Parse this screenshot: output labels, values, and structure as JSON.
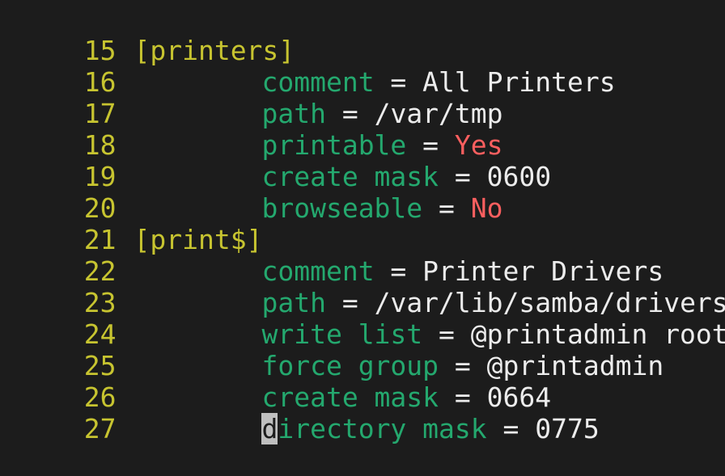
{
  "editor": {
    "lines": [
      {
        "number": "15",
        "type": "section",
        "text": "[printers]"
      },
      {
        "number": "16",
        "type": "kv",
        "key": "comment",
        "op": " = ",
        "value": "All Printers",
        "value_style": "plain"
      },
      {
        "number": "17",
        "type": "kv",
        "key": "path",
        "op": " = ",
        "value": "/var/tmp",
        "value_style": "plain"
      },
      {
        "number": "18",
        "type": "kv",
        "key": "printable",
        "op": " = ",
        "value": "Yes",
        "value_style": "boolean"
      },
      {
        "number": "19",
        "type": "kv",
        "key": "create mask",
        "op": " = ",
        "value": "0600",
        "value_style": "plain"
      },
      {
        "number": "20",
        "type": "kv",
        "key": "browseable",
        "op": " = ",
        "value": "No",
        "value_style": "boolean"
      },
      {
        "number": "21",
        "type": "section",
        "text": "[print$]"
      },
      {
        "number": "22",
        "type": "kv",
        "key": "comment",
        "op": " = ",
        "value": "Printer Drivers",
        "value_style": "plain"
      },
      {
        "number": "23",
        "type": "kv",
        "key": "path",
        "op": " = ",
        "value": "/var/lib/samba/drivers",
        "value_style": "plain"
      },
      {
        "number": "24",
        "type": "kv",
        "key": "write list",
        "op": " = ",
        "value": "@printadmin root",
        "value_style": "plain"
      },
      {
        "number": "25",
        "type": "kv",
        "key": "force group",
        "op": " = ",
        "value": "@printadmin",
        "value_style": "plain"
      },
      {
        "number": "26",
        "type": "kv",
        "key": "create mask",
        "op": " = ",
        "value": "0664",
        "value_style": "plain"
      },
      {
        "number": "27",
        "type": "kv",
        "key": "directory mask",
        "op": " = ",
        "value": "0775",
        "value_style": "plain",
        "cursor_char": "d",
        "key_rest": "irectory mask"
      }
    ],
    "colors": {
      "background": "#1c1c1c",
      "line_number": "#c7c430",
      "section": "#c7c430",
      "key": "#24a86e",
      "text": "#ececec",
      "boolean": "#ff5f5f",
      "cursor_bg": "#bfbfbf"
    }
  }
}
